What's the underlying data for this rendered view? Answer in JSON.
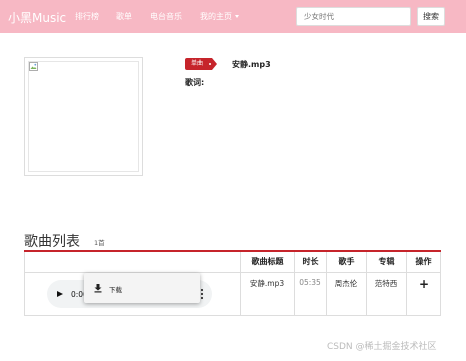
{
  "navbar": {
    "brand": "小黑Music",
    "items": [
      {
        "label": "排行榜"
      },
      {
        "label": "歌单"
      },
      {
        "label": "电台音乐"
      },
      {
        "label": "我的主页"
      }
    ],
    "search_placeholder": "少女时代",
    "search_button": "搜索"
  },
  "song": {
    "badge": "单曲",
    "name": "安静.mp3",
    "lyrics_label": "歌词:"
  },
  "song_list": {
    "title": "歌曲列表",
    "count": "1首",
    "columns": [
      "歌曲标题",
      "时长",
      "歌手",
      "专辑",
      "操作"
    ],
    "rows": [
      {
        "title": "安静.mp3",
        "duration": "05:35",
        "artist": "周杰伦",
        "album": "范特西",
        "action_icon": "plus-icon"
      }
    ]
  },
  "player": {
    "time": "0:00"
  },
  "context_menu": {
    "items": [
      {
        "label": "下载",
        "icon": "download-icon"
      }
    ]
  },
  "watermark": "CSDN @稀土掘金技术社区",
  "colors": {
    "navbar": "#f7b8c4",
    "accent": "#c6242b"
  }
}
